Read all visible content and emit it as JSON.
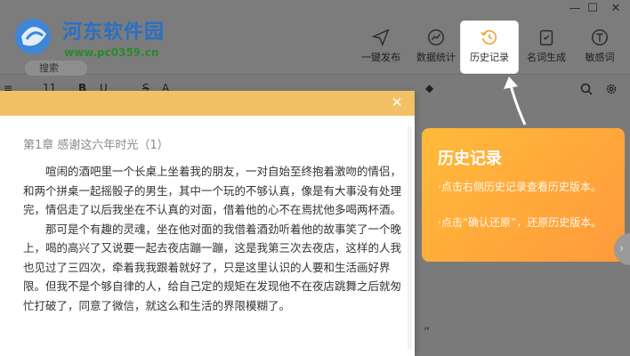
{
  "window": {
    "minimize_glyph": "—",
    "maximize_glyph": "☐",
    "close_glyph": "✕"
  },
  "watermark": {
    "title": "河东软件园",
    "url": "www.pc0359.cn"
  },
  "search": {
    "label": "搜索"
  },
  "toolbar": {
    "items": [
      {
        "label": "一键发布",
        "icon": "paper-plane-icon"
      },
      {
        "label": "数据统计",
        "icon": "chart-icon"
      },
      {
        "label": "历史记录",
        "icon": "history-clock-icon",
        "active": true
      },
      {
        "label": "名词生成",
        "icon": "checklist-icon"
      },
      {
        "label": "敏感词",
        "icon": "t-sensitive-icon"
      }
    ]
  },
  "format_bar": {
    "font_size": "11",
    "bold": "B",
    "underline": "U",
    "strike": "S",
    "font_color": "A"
  },
  "dialog": {
    "close_glyph": "✕",
    "chapter_title": "第1章  感谢这六年时光（1）",
    "paragraphs": [
      "喧闹的酒吧里一个长桌上坐着我的朋友，一对自始至终抱着激吻的情侣，和两个拼桌一起摇骰子的男生，其中一个玩的不够认真，像是有大事没有处理完，情侣走了以后我坐在不认真的对面，借着他的心不在焉扰他多喝两杯酒。",
      "那可是个有趣的灵魂，坐在他对面的我借着酒劲听着他的故事笑了一个晚上，喝的高兴了又说要一起去夜店蹦一蹦，这是我第三次去夜店，这样的人我也见过了三四次，牵着我我跟着就好了，只是这里认识的人要和生活画好界限。但我不是个够自律的人，给自己定的规矩在发现他不在夜店跳舞之后就匆忙打破了，同意了微信，就这么和生活的界限模糊了。"
    ]
  },
  "tooltip": {
    "title": "历史记录",
    "lines": [
      "·点击右侧历史记录查看历史版本。",
      "·点击“确认还原”，还原历史版本。"
    ]
  },
  "editor": {
    "stray_quote": "”"
  },
  "colors": {
    "dialog_header": "#f2c165",
    "tooltip_start": "#ffba3a",
    "tooltip_end": "#ff9a3c",
    "watermark_title": "#2a6fc6",
    "watermark_url": "#2a8a2a"
  }
}
